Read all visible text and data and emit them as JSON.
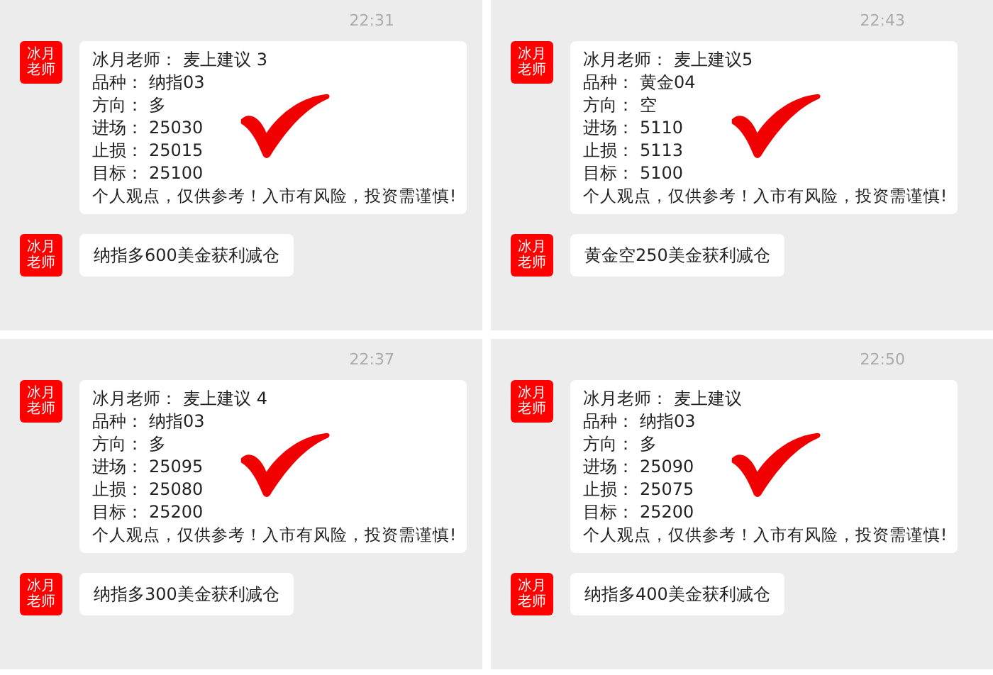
{
  "panels": [
    {
      "time": "22:31",
      "signal": {
        "avatar": "冰月老师",
        "header": {
          "label": "冰月老师：",
          "value": "麦上建议 3"
        },
        "fields": [
          {
            "label": "品种：",
            "value": "纳指03"
          },
          {
            "label": "方向：",
            "value": "多"
          },
          {
            "label": "进场：",
            "value": "25030"
          },
          {
            "label": "止损：",
            "value": "25015"
          },
          {
            "label": "目标：",
            "value": "25100"
          }
        ],
        "disclaimer": "个人观点，仅供参考！入市有风险，投资需谨慎!"
      },
      "followup": {
        "avatar": "冰月老师",
        "text": "纳指多600美金获利减仓"
      }
    },
    {
      "time": "22:43",
      "signal": {
        "avatar": "冰月老师",
        "header": {
          "label": "冰月老师：",
          "value": "麦上建议5"
        },
        "fields": [
          {
            "label": "品种：",
            "value": "黄金04"
          },
          {
            "label": "方向：",
            "value": "空"
          },
          {
            "label": "进场：",
            "value": "5110"
          },
          {
            "label": "止损：",
            "value": "5113"
          },
          {
            "label": "目标：",
            "value": "5100"
          }
        ],
        "disclaimer": "个人观点，仅供参考！入市有风险，投资需谨慎!"
      },
      "followup": {
        "avatar": "冰月老师",
        "text": "黄金空250美金获利减仓"
      }
    },
    {
      "time": "22:37",
      "signal": {
        "avatar": "冰月老师",
        "header": {
          "label": "冰月老师：",
          "value": "麦上建议 4"
        },
        "fields": [
          {
            "label": "品种：",
            "value": "纳指03"
          },
          {
            "label": "方向：",
            "value": "多"
          },
          {
            "label": "进场：",
            "value": "25095"
          },
          {
            "label": "止损：",
            "value": "25080"
          },
          {
            "label": "目标：",
            "value": "25200"
          }
        ],
        "disclaimer": "个人观点，仅供参考！入市有风险，投资需谨慎!"
      },
      "followup": {
        "avatar": "冰月老师",
        "text": "纳指多300美金获利减仓"
      }
    },
    {
      "time": "22:50",
      "signal": {
        "avatar": "冰月老师",
        "header": {
          "label": "冰月老师：",
          "value": "麦上建议"
        },
        "fields": [
          {
            "label": "品种：",
            "value": "纳指03"
          },
          {
            "label": "方向：",
            "value": "多"
          },
          {
            "label": "进场：",
            "value": "25090"
          },
          {
            "label": "止损：",
            "value": "25075"
          },
          {
            "label": "目标：",
            "value": "25200"
          }
        ],
        "disclaimer": "个人观点，仅供参考！入市有风险，投资需谨慎!"
      },
      "followup": {
        "avatar": "冰月老师",
        "text": "纳指多400美金获利减仓"
      }
    }
  ]
}
